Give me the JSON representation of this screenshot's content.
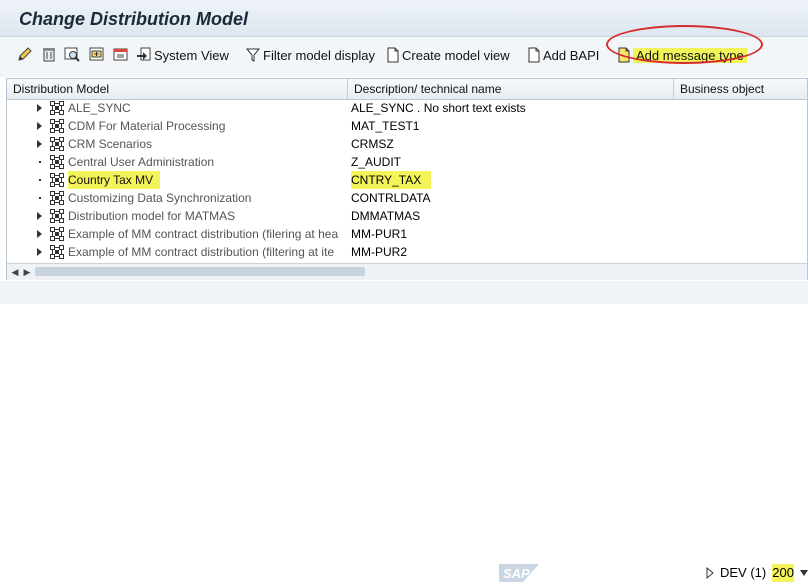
{
  "window": {
    "title": "Change Distribution Model"
  },
  "toolbar": {
    "icons": [
      "edit-icon",
      "delete-icon",
      "display-icon",
      "create-icon",
      "execute-icon"
    ],
    "system_view": "System View",
    "filter_model_display": "Filter model display",
    "create_model_view": "Create model view",
    "add_bapi": "Add BAPI",
    "add_message_type": "Add message type",
    "highlight_color": "#f3f35a",
    "annotation_color": "#d62b2b"
  },
  "table": {
    "headers": [
      "Distribution Model",
      "Description/ technical name",
      "Business object"
    ],
    "rows": [
      {
        "name": "ALE_SYNC",
        "desc": "ALE_SYNC  . No short text exists",
        "expand": "arrow",
        "highlighted": false
      },
      {
        "name": "CDM For Material Processing",
        "desc": "MAT_TEST1",
        "expand": "arrow",
        "highlighted": false
      },
      {
        "name": "CRM Scenarios",
        "desc": "CRMSZ",
        "expand": "arrow",
        "highlighted": false
      },
      {
        "name": "Central User Administration",
        "desc": "Z_AUDIT",
        "expand": "dot",
        "highlighted": false
      },
      {
        "name": "Country Tax MV",
        "desc": "CNTRY_TAX",
        "expand": "dot",
        "highlighted": true
      },
      {
        "name": "Customizing Data Synchronization",
        "desc": "CONTRLDATA",
        "expand": "dot",
        "highlighted": false
      },
      {
        "name": "Distribution model for MATMAS",
        "desc": "DMMATMAS",
        "expand": "arrow",
        "highlighted": false
      },
      {
        "name": "Example of MM contract distribution (filering at hea",
        "desc": "MM-PUR1",
        "expand": "arrow",
        "highlighted": false
      },
      {
        "name": "Example of MM contract distribution (filtering at ite",
        "desc": "MM-PUR2",
        "expand": "arrow",
        "highlighted": false
      }
    ]
  },
  "statusbar": {
    "logo_text": "SAP",
    "system": "DEV (1)",
    "client": "200"
  }
}
